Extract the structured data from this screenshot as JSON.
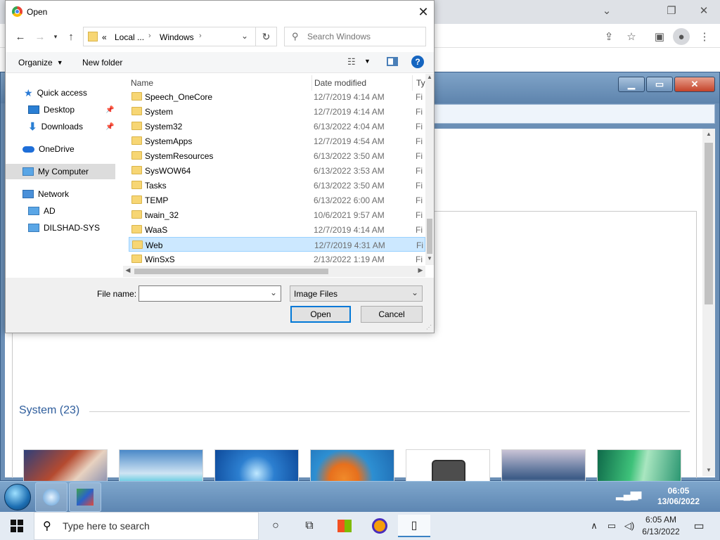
{
  "dialog": {
    "title": "Open",
    "address": {
      "prefix": "«",
      "part1": "Local ...",
      "part2": "Windows"
    },
    "search_placeholder": "Search Windows",
    "organize_label": "Organize",
    "new_folder_label": "New folder",
    "help_label": "?"
  },
  "nav_pane": {
    "quick_access": "Quick access",
    "desktop": "Desktop",
    "downloads": "Downloads",
    "onedrive": "OneDrive",
    "my_computer": "My Computer",
    "network": "Network",
    "ad": "AD",
    "dilshad_sys": "DILSHAD-SYS"
  },
  "file_list": {
    "columns": {
      "name": "Name",
      "date": "Date modified",
      "type": "Ty"
    },
    "rows": [
      {
        "name": "Speech_OneCore",
        "date": "12/7/2019 4:14 AM",
        "type": "Fi"
      },
      {
        "name": "System",
        "date": "12/7/2019 4:14 AM",
        "type": "Fi"
      },
      {
        "name": "System32",
        "date": "6/13/2022 4:04 AM",
        "type": "Fi"
      },
      {
        "name": "SystemApps",
        "date": "12/7/2019 4:54 AM",
        "type": "Fi"
      },
      {
        "name": "SystemResources",
        "date": "6/13/2022 3:50 AM",
        "type": "Fi"
      },
      {
        "name": "SysWOW64",
        "date": "6/13/2022 3:53 AM",
        "type": "Fi"
      },
      {
        "name": "Tasks",
        "date": "6/13/2022 3:50 AM",
        "type": "Fi"
      },
      {
        "name": "TEMP",
        "date": "6/13/2022 6:00 AM",
        "type": "Fi"
      },
      {
        "name": "twain_32",
        "date": "10/6/2021 9:57 AM",
        "type": "Fi"
      },
      {
        "name": "WaaS",
        "date": "12/7/2019 4:14 AM",
        "type": "Fi"
      },
      {
        "name": "Web",
        "date": "12/7/2019 4:31 AM",
        "type": "Fi",
        "selected": true
      },
      {
        "name": "WinSxS",
        "date": "2/13/2022 1:19 AM",
        "type": "Fi"
      }
    ]
  },
  "bottom": {
    "file_name_label": "File name:",
    "file_name_value": "",
    "filter": "Image Files",
    "open_label": "Open",
    "cancel_label": "Cancel"
  },
  "background_window": {
    "section_title": "System (23)"
  },
  "win7_taskbar": {
    "time": "06:05",
    "date": "13/06/2022"
  },
  "win10_taskbar": {
    "search_placeholder": "Type here to search",
    "time": "6:05 AM",
    "date": "6/13/2022"
  }
}
